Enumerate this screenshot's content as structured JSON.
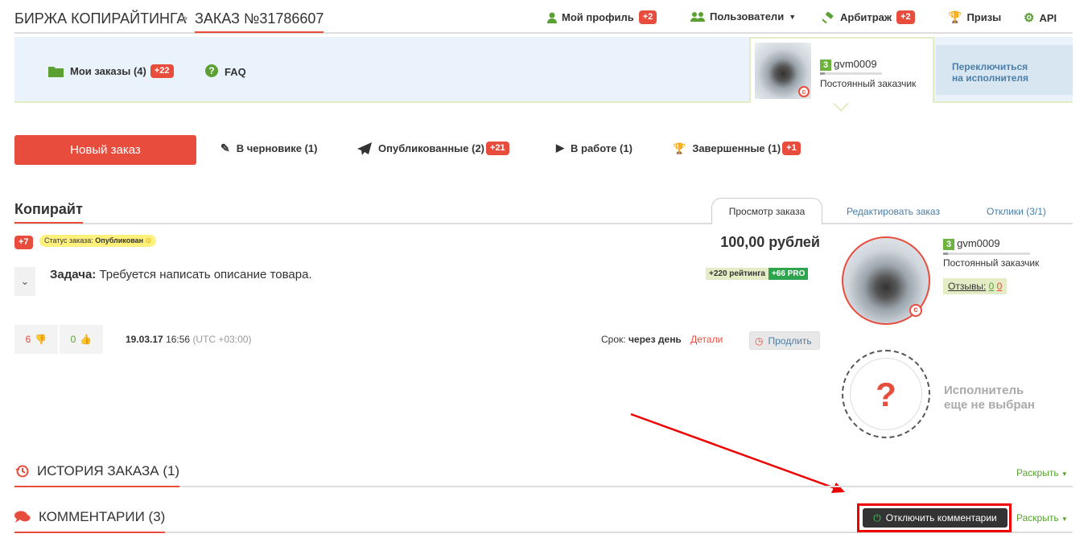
{
  "top": {
    "brand": "БИРЖА КОПИРАЙТИНГА",
    "separator": ">",
    "order_title": "ЗАКАЗ №31786607",
    "nav": {
      "profile": {
        "label": "Мой профиль",
        "badge": "+2"
      },
      "users": {
        "label": "Пользователи"
      },
      "arbitrage": {
        "label": "Арбитраж",
        "badge": "+2"
      },
      "prizes": {
        "label": "Призы"
      },
      "api": {
        "label": "API"
      }
    }
  },
  "subheader": {
    "my_orders": {
      "label": "Мои заказы (4)",
      "badge": "+22"
    },
    "faq": "FAQ",
    "user": {
      "level": "3",
      "name": "gvm0009",
      "role": "Постоянный заказчик"
    },
    "switch_label_1": "Переключиться",
    "switch_label_2": "на исполнителя"
  },
  "actions": {
    "new_order": "Новый заказ",
    "drafts": "В черновике (1)",
    "published": {
      "label": "Опубликованные (2)",
      "badge": "+21"
    },
    "in_work": "В работе (1)",
    "completed": {
      "label": "Завершенные (1)",
      "badge": "+1"
    }
  },
  "order": {
    "category": "Копирайт",
    "tabs": {
      "view": "Просмотр заказа",
      "edit": "Редактировать заказ",
      "responses": "Отклики (3/1)"
    },
    "badge": "+7",
    "status_label": "Статус заказа:",
    "status_value": "Опубликован",
    "price": "100,00 рублей",
    "task_label": "Задача:",
    "task_text": "Требуется написать описание товара.",
    "rating_plus": "+220 рейтинга",
    "rating_pro": "+66 PRO",
    "votes_down": "6",
    "votes_up": "0",
    "date": "19.03.17",
    "time": "16:56",
    "tz": "(UTC +03:00)",
    "deadline_label": "Срок:",
    "deadline_value": "через день",
    "details": "Детали",
    "prolong": "Продлить"
  },
  "customer": {
    "level": "3",
    "name": "gvm0009",
    "role": "Постоянный заказчик",
    "reviews_label": "Отзывы:",
    "reviews_pos": "0",
    "reviews_neg": "0"
  },
  "executor": {
    "line1": "Исполнитель",
    "line2": "еще не выбран"
  },
  "history": {
    "title": "ИСТОРИЯ ЗАКАЗА (1)",
    "expand": "Раскрыть"
  },
  "comments": {
    "title": "КОММЕНТАРИИ (3)",
    "disable": "Отключить комментарии",
    "expand": "Раскрыть"
  },
  "colors": {
    "accent": "#e84c3d",
    "green": "#5aa033",
    "link": "#4a7ea8"
  }
}
